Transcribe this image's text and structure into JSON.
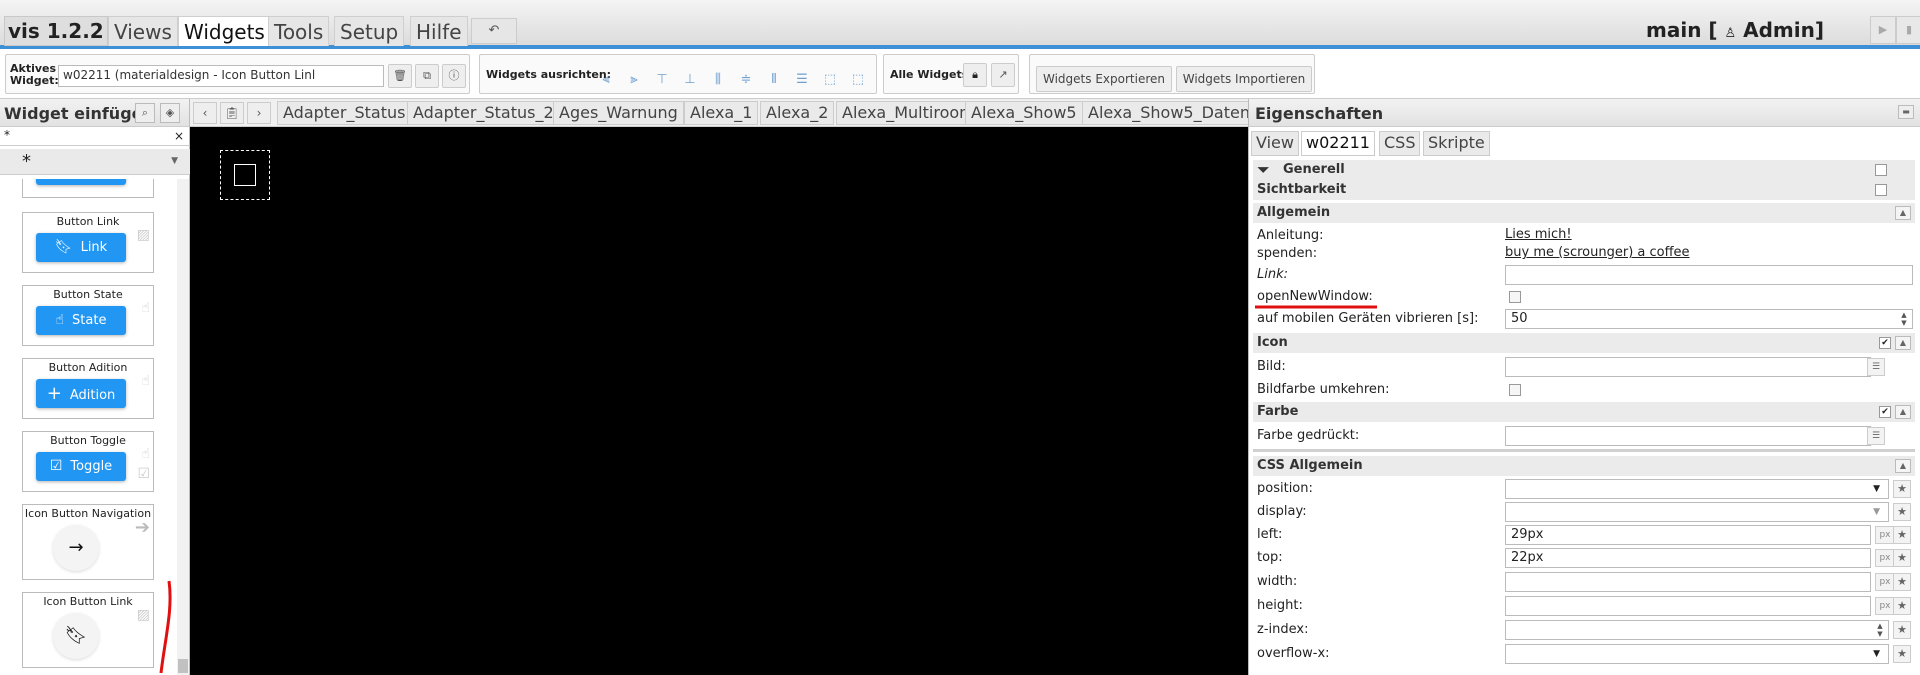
{
  "menubar": {
    "logo": "vis 1.2.2",
    "tabs": [
      "Views",
      "Widgets",
      "Tools",
      "Setup",
      "Hilfe"
    ],
    "undo_icon": "undo-icon",
    "project": "main [",
    "user_icon": "user-icon",
    "user": "Admin]"
  },
  "toolbar": {
    "active_widget_label": "Aktives Widget:",
    "active_widget_value": "w02211 (materialdesign - Icon Button Linl",
    "align_label": "Widgets ausrichten:",
    "all_widgets_label": "Alle Widgets:",
    "export_label": "Widgets Exportieren",
    "import_label": "Widgets Importieren"
  },
  "left": {
    "title": "Widget einfügen",
    "filter_value": "*",
    "filter_clear": "×",
    "set_value": "*",
    "widgets": [
      {
        "name": "Button Link",
        "label": "Link",
        "icon": "bookmark-icon"
      },
      {
        "name": "Button State",
        "label": "State",
        "icon": "hand-pointer-icon"
      },
      {
        "name": "Button Adition",
        "label": "Adition",
        "icon": "plus-icon"
      },
      {
        "name": "Button Toggle",
        "label": "Toggle",
        "icon": "checkbox-icon"
      },
      {
        "name": "Icon Button Navigation",
        "label": "",
        "icon": "arrow-right-icon"
      },
      {
        "name": "Icon Button Link",
        "label": "",
        "icon": "bookmark-icon"
      }
    ]
  },
  "canvas": {
    "views": [
      "Adapter_Status",
      "Adapter_Status_2",
      "Ages_Warnung",
      "Alexa_1",
      "Alexa_2",
      "Alexa_Multiroom",
      "Alexa_Show5",
      "Alexa_Show5_Daten"
    ]
  },
  "props": {
    "title": "Eigenschaften",
    "tabs": [
      "View",
      "w02211",
      "CSS",
      "Skripte"
    ],
    "sections": {
      "generell": "Generell",
      "sichtbarkeit": "Sichtbarkeit",
      "allgemein": "Allgemein",
      "icon": "Icon",
      "farbe": "Farbe",
      "css_allgemein": "CSS Allgemein"
    },
    "rows": {
      "anleitung": {
        "key": "Anleitung:",
        "value": "Lies mich!"
      },
      "spenden": {
        "key": "spenden:",
        "value": "buy me (scrounger) a coffee"
      },
      "link": {
        "key": "Link:",
        "value": ""
      },
      "open_new_window": {
        "key": "openNewWindow:"
      },
      "vibrate": {
        "key": "auf mobilen Geräten vibrieren [s]:",
        "value": "50"
      },
      "bild": {
        "key": "Bild:",
        "value": ""
      },
      "bildfarbe": {
        "key": "Bildfarbe umkehren:"
      },
      "farbe_gedrueckt": {
        "key": "Farbe gedrückt:",
        "value": ""
      },
      "position": {
        "key": "position:",
        "value": ""
      },
      "display": {
        "key": "display:",
        "value": ""
      },
      "left": {
        "key": "left:",
        "value": "29px"
      },
      "top": {
        "key": "top:",
        "value": "22px"
      },
      "width": {
        "key": "width:",
        "value": ""
      },
      "height": {
        "key": "height:",
        "value": ""
      },
      "z_index": {
        "key": "z-index:",
        "value": ""
      },
      "overflow_x": {
        "key": "overflow-x:",
        "value": ""
      }
    },
    "unit_px": "px"
  },
  "colors": {
    "accent": "#3d8fd6",
    "button_blue": "#2196f3",
    "annotation_red": "#e01010"
  }
}
